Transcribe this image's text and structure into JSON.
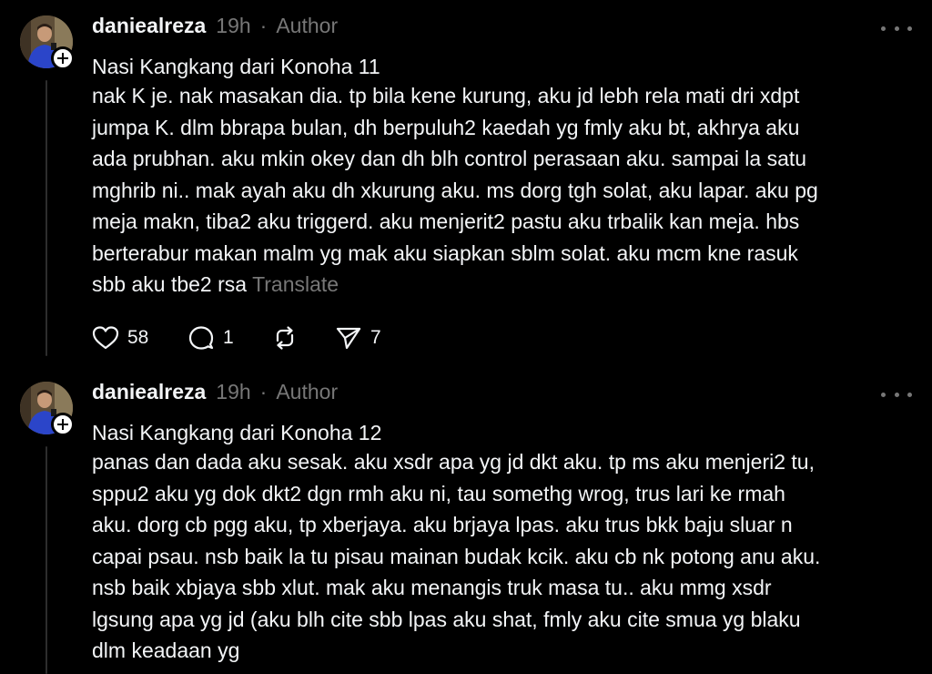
{
  "posts": [
    {
      "username": "daniealreza",
      "time": "19h",
      "separator": "·",
      "role": "Author",
      "title": "Nasi Kangkang dari Konoha 11",
      "body_lines": [
        "nak K je. nak masakan dia. tp bila kene kurung, aku jd lebh rela mati dri xdpt",
        "jumpa K. dlm bbrapa bulan, dh berpuluh2 kaedah yg fmly aku bt, akhrya aku",
        "ada prubhan. aku mkin okey dan dh blh control perasaan aku. sampai la satu",
        "mghrib ni.. mak ayah aku dh xkurung aku. ms dorg tgh solat, aku lapar. aku pg",
        "meja makn, tiba2 aku triggerd. aku menjerit2 pastu aku trbalik kan meja. hbs",
        "berterabur makan malm yg mak aku siapkan sblm solat. aku mcm kne rasuk",
        "sbb aku tbe2 rsa"
      ],
      "translate_label": "Translate",
      "likes": "58",
      "replies": "1",
      "shares": "7"
    },
    {
      "username": "daniealreza",
      "time": "19h",
      "separator": "·",
      "role": "Author",
      "title": "Nasi Kangkang dari Konoha 12",
      "body_lines": [
        "panas dan dada aku sesak. aku xsdr apa yg jd dkt aku. tp ms aku menjeri2 tu,",
        "sppu2 aku yg dok dkt2 dgn rmh aku ni, tau somethg wrog, trus lari ke rmah",
        "aku. dorg cb pgg aku, tp xberjaya. aku brjaya lpas. aku trus bkk baju sluar n",
        "capai psau. nsb baik la tu pisau mainan budak kcik. aku cb nk potong anu aku.",
        "nsb baik xbjaya sbb xlut. mak aku menangis truk masa tu.. aku mmg xsdr",
        "lgsung apa yg jd (aku blh cite sbb lpas aku shat, fmly aku cite smua yg blaku",
        "dlm keadaan yg"
      ]
    }
  ],
  "icons": {
    "like": "heart-icon",
    "reply": "comment-icon",
    "repost": "repost-icon",
    "share": "send-icon",
    "more": "more-horizontal-icon",
    "follow": "plus-icon"
  },
  "colors": {
    "background": "#000000",
    "primary_text": "#f3f5f7",
    "secondary_text": "#777777",
    "thread_line": "#2d2d2d"
  }
}
